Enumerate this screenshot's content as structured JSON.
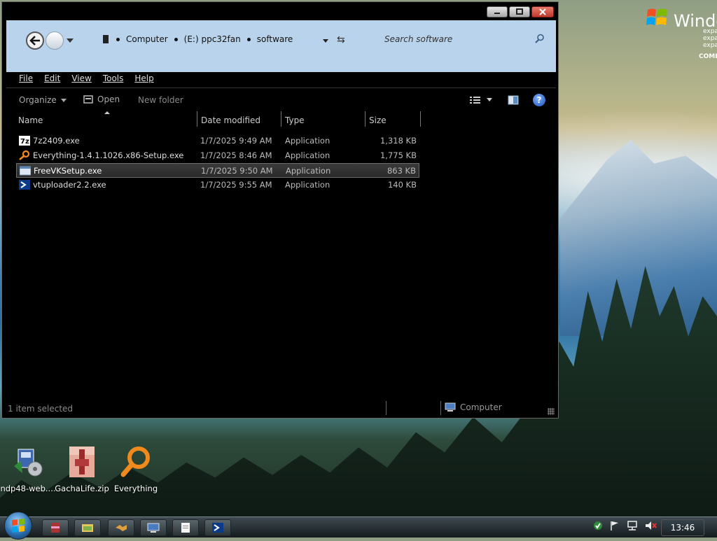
{
  "desktop": {
    "logo_text": "Windo",
    "logo_sub": [
      "expa",
      "expa",
      "expa",
      "COMI"
    ],
    "icons": [
      {
        "label": "ndp48-web....",
        "icon": "installer-icon"
      },
      {
        "label": "GachaLife.zip",
        "icon": "zip-archive-icon"
      },
      {
        "label": "Everything",
        "icon": "magnifier-icon"
      }
    ]
  },
  "window": {
    "breadcrumb": [
      "Computer",
      "(E:) ppc32fan",
      "software"
    ],
    "search_placeholder": "Search software",
    "menu": [
      "File",
      "Edit",
      "View",
      "Tools",
      "Help"
    ],
    "toolbar": {
      "organize": "Organize",
      "open": "Open",
      "new_folder": "New folder"
    },
    "columns": {
      "name": "Name",
      "date": "Date modified",
      "type": "Type",
      "size": "Size"
    },
    "files": [
      {
        "name": "7z2409.exe",
        "date": "1/7/2025 9:49 AM",
        "type": "Application",
        "size": "1,318 KB",
        "icon": "7zip-icon"
      },
      {
        "name": "Everything-1.4.1.1026.x86-Setup.exe",
        "date": "1/7/2025 8:46 AM",
        "type": "Application",
        "size": "1,775 KB",
        "icon": "magnifier-icon"
      },
      {
        "name": "FreeVKSetup.exe",
        "date": "1/7/2025 9:50 AM",
        "type": "Application",
        "size": "863 KB",
        "icon": "app-window-icon",
        "selected": true
      },
      {
        "name": "vtuploader2.2.exe",
        "date": "1/7/2025 9:55 AM",
        "type": "Application",
        "size": "140 KB",
        "icon": "vt-icon"
      }
    ],
    "status": {
      "selection": "1 item selected",
      "zone": "Computer"
    }
  },
  "taskbar": {
    "clock": "13:46",
    "items": [
      "winrar-icon",
      "explorer-icon",
      "handshake-icon",
      "remote-desktop-icon",
      "notepad-icon",
      "vt-icon"
    ],
    "tray": [
      "security-check-icon",
      "action-flag-icon",
      "network-icon",
      "volume-muted-icon"
    ]
  }
}
